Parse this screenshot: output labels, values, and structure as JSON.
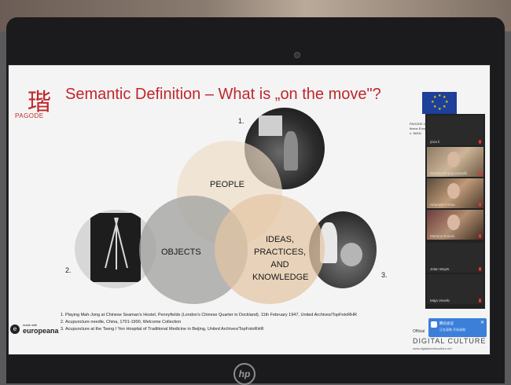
{
  "slide": {
    "logo_text": "PAGODE",
    "logo_glyph": "瑎",
    "title": "Semantic Definition – What is „on the move\"?",
    "funding_text": "PAGODE co-financ Europe n. INEA/",
    "venn": {
      "people": "PEOPLE",
      "objects": "OBJECTS",
      "ideas": "IDEAS, PRACTICES, AND KNOWLEDGE"
    },
    "numbers": [
      "1.",
      "2.",
      "3."
    ],
    "footnotes": [
      "Playing Mah-Jong at Chinese Seaman's Hostel, Pennyfields (London's Chinese Quarter in Dockland). 11th February 1947, United Archives/TopFotoRHR",
      "Acupuncture needle, China, 1701-1900, Welcome Collection",
      "Acupuncture at the Tseng I Yen Hospital of Traditional Medicine in Beijing, United Archives/TopFotoRHR"
    ],
    "europeana_small": "made with",
    "europeana_big": "europeana",
    "official_text": "Official",
    "digital_culture": "DIGITAL CULTURE",
    "digital_culture_url": "www.digitalmeetsculture.net"
  },
  "video_call": {
    "participants": [
      {
        "name": "yixiu li",
        "video": false
      },
      {
        "name": "Natalia Iampaij Suhadik",
        "video": true
      },
      {
        "name": "Antonella Fresa",
        "video": true
      },
      {
        "name": "Marlene Bolutin",
        "video": true
      },
      {
        "name": "Jelan Wayts",
        "video": false
      },
      {
        "name": "Maja Veselic",
        "video": false
      }
    ],
    "notification": {
      "title": "腾讯会议",
      "text": "正在录制 开始录制",
      "close": "✕"
    }
  },
  "laptop": {
    "brand_logo": "hp"
  },
  "colors": {
    "title_red": "#c0262b",
    "eu_blue": "#1e3f9a",
    "notify_blue": "#3b7fd9"
  }
}
